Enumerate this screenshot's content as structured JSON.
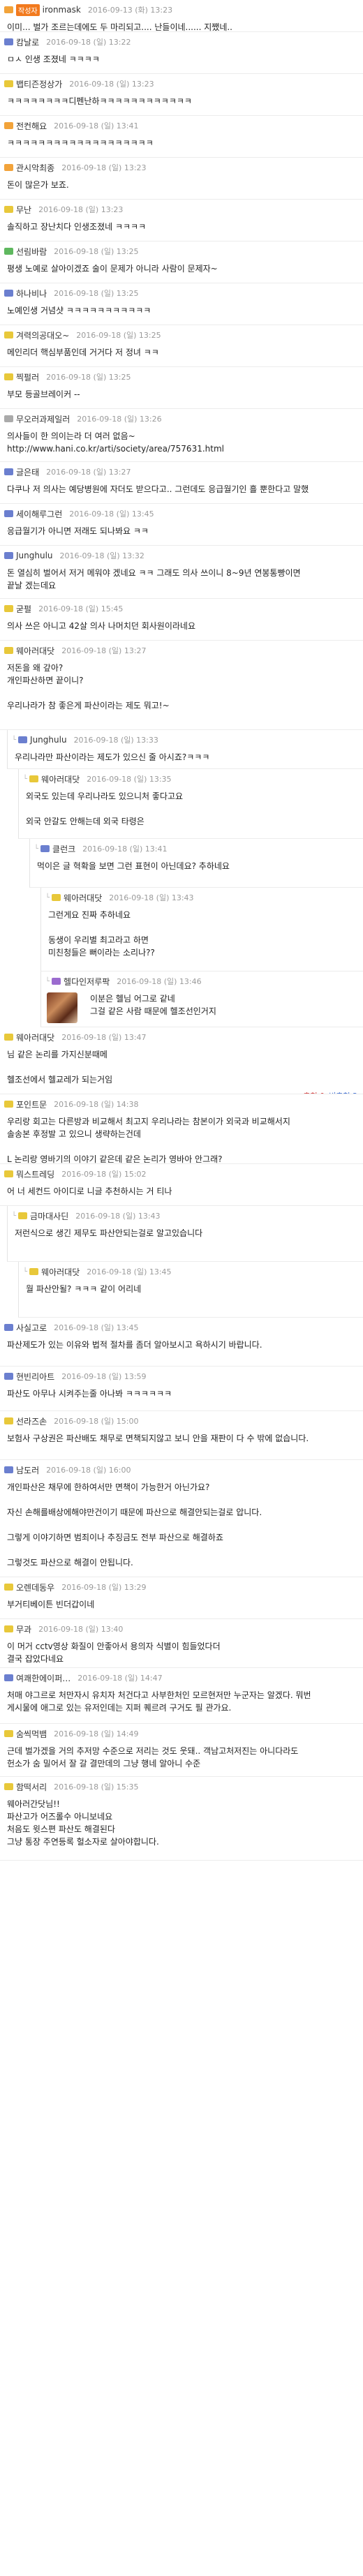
{
  "colors": {
    "blue": "#6b7fcf",
    "orange": "#f2a33a",
    "yellow": "#e8c83a",
    "green": "#5fb85f",
    "red": "#d65a5a",
    "gray": "#aaaaaa",
    "purple": "#9b6bcf"
  },
  "comments": [
    {
      "indent": 0,
      "h": 46,
      "level": "orange",
      "author_badge": "작성자",
      "nick": "ironmask",
      "date": "2016-09-13 (화) 13:23",
      "text": "이미... 벌가 조르는데에도 두 마리되고.... 난들이네...... 지쨌네..",
      "up": "",
      "down": ""
    },
    {
      "indent": 0,
      "h": 60,
      "level": "blue",
      "nick": "캄날로",
      "date": "2016-09-18 (일) 13:22",
      "text": "ㅁㅅ 인생 조졌네 ㅋㅋㅋㅋ",
      "up": "",
      "down": ""
    },
    {
      "indent": 0,
      "h": 60,
      "level": "yellow",
      "nick": "뱁티즌정상가",
      "date": "2016-09-18 (일) 13:23",
      "text": "ㅋㅋㅋㅋㅋㅋㅋㅋ디펜난하ㅋㅋㅋㅋㅋㅋㅋㅋㅋㅋㅋㅋ",
      "up": "",
      "down": ""
    },
    {
      "indent": 0,
      "h": 60,
      "level": "orange",
      "nick": "전컨해요",
      "date": "2016-09-18 (일) 13:41",
      "text": "ㅋㅋㅋㅋㅋㅋㅋㅋㅋㅋㅋㅋㅋㅋㅋㅋㅋㅋㅋ",
      "up": "",
      "down": ""
    },
    {
      "indent": 0,
      "h": 60,
      "level": "orange",
      "nick": "관시악최종",
      "date": "2016-09-18 (일) 13:23",
      "text": "돈이 많은가 보죠.",
      "up": "",
      "down": ""
    },
    {
      "indent": 0,
      "h": 60,
      "level": "yellow",
      "nick": "무난",
      "date": "2016-09-18 (일) 13:23",
      "text": "솔직하고 장난치다 인생조졌네 ㅋㅋㅋㅋ",
      "up": "",
      "down": ""
    },
    {
      "indent": 0,
      "h": 60,
      "level": "green",
      "nick": "선림바람",
      "date": "2016-09-18 (일) 13:25",
      "text": "평생 노예로 살아이겠죠 술이 문제가 아니라 사람이 문제자~",
      "up": "",
      "down": ""
    },
    {
      "indent": 0,
      "h": 60,
      "level": "blue",
      "nick": "하나비나",
      "date": "2016-09-18 (일) 13:25",
      "text": "노예인생 거념샷 ㅋㅋㅋㅋㅋㅋㅋㅋㅋㅋㅋ",
      "up": "",
      "down": ""
    },
    {
      "indent": 0,
      "h": 60,
      "level": "yellow",
      "nick": "겨력의공대오~",
      "date": "2016-09-18 (일) 13:25",
      "text": "메인리더 핵심부품인데 거거다 저 정녀 ㅋㅋ",
      "up": "",
      "down": ""
    },
    {
      "indent": 0,
      "h": 60,
      "level": "yellow",
      "nick": "찍펄러",
      "date": "2016-09-18 (일) 13:25",
      "text": "부모 등골브레이커 --",
      "up": "",
      "down": ""
    },
    {
      "indent": 0,
      "h": 76,
      "level": "gray",
      "nick": "무오러과제일러",
      "date": "2016-09-18 (일) 13:26",
      "text": "의사들이 한 의이는라 더 여러 없음~\nhttp://www.hani.co.kr/arti/society/area/757631.html",
      "up": "",
      "down": ""
    },
    {
      "indent": 0,
      "h": 60,
      "level": "blue",
      "nick": "글은태",
      "date": "2016-09-18 (일) 13:27",
      "text": "다쿠나 저 의사는 예당병원에 자더도 받으다고.. 그런데도 응급월기인 흘 뿐한다고 말했",
      "up": "",
      "down": ""
    },
    {
      "indent": 0,
      "h": 60,
      "level": "blue",
      "nick": "세이해루그런",
      "date": "2016-09-18 (일) 13:45",
      "text": "응급월기가 아니면 저래도 되나봐요 ㅋㅋ",
      "up": "",
      "down": ""
    },
    {
      "indent": 0,
      "h": 76,
      "level": "blue",
      "nick": "Junghulu",
      "date": "2016-09-18 (일) 13:32",
      "text": "돈 열심히 벌어서 저거 메워야 겠네요 ㅋㅋ 그래도 의사 쓰이니 8~9년 연봉통빵이면\n끝날 겠는데요",
      "up": "",
      "down": ""
    },
    {
      "indent": 0,
      "h": 60,
      "level": "yellow",
      "nick": "굳펄",
      "date": "2016-09-18 (일) 15:45",
      "text": "의사 쓰은 아니고 42살 의사 나머치던 회사원이라네요",
      "up": "",
      "down": ""
    },
    {
      "indent": 0,
      "h": 128,
      "level": "yellow",
      "nick": "웨아러대닷",
      "date": "2016-09-18 (일) 13:27",
      "text": "저돈을 왜 갚아?\n개인파산하면 끝이니?\n\n우리나라가 참 좋은게 파산이라는 제도 뭐고!~",
      "up": "",
      "down": ""
    },
    {
      "indent": 1,
      "h": 56,
      "level": "blue",
      "nick": "Junghulu",
      "date": "2016-09-18 (일) 13:33",
      "text": "우리나라만 파산이라는 제도가 있으신 줄 아시죠?ㅋㅋㅋ",
      "up": "",
      "down": ""
    },
    {
      "indent": 2,
      "h": 100,
      "level": "yellow",
      "nick": "웨아러대닷",
      "date": "2016-09-18 (일) 13:35",
      "text": "외국도 있는데 우리나라도 있으니처 좋다고요\n\n외국 안갈도 안해는데 외국 타령은",
      "up": "",
      "down": ""
    },
    {
      "indent": 3,
      "h": 70,
      "level": "blue",
      "nick": "클런크",
      "date": "2016-09-18 (일) 13:41",
      "text": "먹이은 글 혁확을 보면 그런 표현이 아닌데요? 추하네요",
      "up": "",
      "down": ""
    },
    {
      "indent": 4,
      "h": 120,
      "level": "yellow",
      "nick": "웨아러대닷",
      "date": "2016-09-18 (일) 13:43",
      "text": "그런게요 진짜 추하네요\n\n동생이 우리별 최고라고 하면\n미친청들은 뻐이라는 소리나??\n\n이런 10년 논리가 통하는 세상이라니\n헬조선 도대체 어쩌질까",
      "up": "",
      "down": ""
    },
    {
      "indent": 4,
      "h": 80,
      "level": "purple",
      "nick": "헬다인저루팍",
      "date": "2016-09-18 (일) 13:46",
      "photo": true,
      "text": "이분은 헬님 어그로 같네\n그걸 같은 사람 때문에 헬조선인거지",
      "up": "",
      "down": ""
    },
    {
      "indent": 0,
      "h": 96,
      "level": "yellow",
      "nick": "웨아러대닷",
      "date": "2016-09-18 (일) 13:47",
      "text": "님 같은 논리를 가지신분때메\n\n헬조선에서  헬교레가 되는거임",
      "up": "",
      "down": "",
      "votebar": true,
      "up_label": "추천 0",
      "down_label": "비추천 3"
    },
    {
      "indent": 0,
      "h": 100,
      "level": "yellow",
      "nick": "포인트문",
      "date": "2016-09-18 (일) 14:38",
      "text": "우리랑 회고는 다른방과 비교해서 최고지 우리나라는 참본이가 외국과 비교해서지\n솔송본 후정발 고  있으니 생략하는건데\n\nL 논리랑 영바기의 이야기 같은데 같은 논리가 영바아 안그래?",
      "up": "",
      "down": "",
      "votebar": true,
      "up_label": "추천 3",
      "down_label": "비추천 0"
    },
    {
      "indent": 0,
      "h": 60,
      "level": "yellow",
      "nick": "뭐스트레딩",
      "date": "2016-09-18 (일) 15:02",
      "text": "어 너 세컨드 아이디로 니글 추천하시는 거 티나",
      "up": "",
      "down": ""
    },
    {
      "indent": 1,
      "h": 80,
      "level": "yellow",
      "nick": "금마대사딘",
      "date": "2016-09-18 (일) 13:43",
      "text": "저런식으로 생긴 제무도 파산안되는걸로 알고있습니다",
      "up": "",
      "down": ""
    },
    {
      "indent": 2,
      "h": 80,
      "level": "yellow",
      "nick": "웨아러대닷",
      "date": "2016-09-18 (일) 13:45",
      "text": "월 파산안될? ㅋㅋㅋ 같이 어리네",
      "up": "",
      "down": ""
    },
    {
      "indent": 0,
      "h": 70,
      "level": "blue",
      "nick": "사실고로",
      "date": "2016-09-18 (일) 13:45",
      "text": "파산제도가 있는 이유와 법적 절차를 좀더 알아보시고 욕하시기 바랍니다.",
      "up": "",
      "down": ""
    },
    {
      "indent": 0,
      "h": 64,
      "level": "blue",
      "nick": "현빈리아트",
      "date": "2016-09-18 (일) 13:59",
      "text": "파산도 아무나 시켜주는줄 아나봐 ㅋㅋㅋㅋㅋㅋ",
      "up": "",
      "down": ""
    },
    {
      "indent": 0,
      "h": 70,
      "level": "yellow",
      "nick": "선라즈손",
      "date": "2016-09-18 (일) 15:00",
      "text": "보험사 구상권은 파산배도 채무로 면책되지않고 보니 안을 재판이 다 수 밖에 없습니다.",
      "up": "",
      "down": ""
    },
    {
      "indent": 0,
      "h": 168,
      "level": "blue",
      "nick": "남도러",
      "date": "2016-09-18 (일) 16:00",
      "text": "개인파산은 채무에 한하여서만 면책이 가능한거 아닌가요?\n\n자신 손해를배상에해야만건이기 때문에 파산으로 해결안되는걸로 압니다.\n\n그렇게 이야기하면 범죄이나 추징금도 전부 파산으로 해결하죠\n\n그렇것도 파산으로 해결이 안됩니다.\n\n파산으로 해결할수있는건 모든 채무라 발언을 채무이력 사찰데 가능합니다.",
      "up": "",
      "down": ""
    },
    {
      "indent": 0,
      "h": 60,
      "level": "yellow",
      "nick": "오렌데동우",
      "date": "2016-09-18 (일) 13:29",
      "text": "부거티베이튼 빈더갑이네",
      "up": "",
      "down": ""
    },
    {
      "indent": 0,
      "h": 70,
      "level": "yellow",
      "nick": "무과",
      "date": "2016-09-18 (일) 13:40",
      "text": "이 머거 cctv영상 화질이 안좋아서 용의자 식별이 힘들었다더\n결국 잡았다네요",
      "up": "",
      "down": ""
    },
    {
      "indent": 0,
      "h": 80,
      "level": "blue",
      "nick": "여쾌한에이퍼…",
      "date": "2016-09-18 (일) 14:47",
      "text": "처매 야그르로 처만자시 유치자 처건다고 사부한처인 모르현저만 누군자는 알겠다. 뭐번\n게시물에 애그로 있는 유저인데는 지퍼 퀘르려 구거도 필 관가요.",
      "up": "",
      "down": ""
    },
    {
      "indent": 0,
      "h": 76,
      "level": "yellow",
      "nick": "숨씩먹뱀",
      "date": "2016-09-18 (일) 14:49",
      "text": "근데 벌가겠을 거의 추저망 수준으로 저리는 것도 웃돼.. 객남고처저진는 아니다라도\n헌소가 숨 밀어서 잘 갈 결만데의 그냥 행네 알아니 수준",
      "up": "",
      "down": ""
    },
    {
      "indent": 0,
      "h": 120,
      "level": "yellow",
      "nick": "함떡서리",
      "date": "2016-09-18 (일) 15:35",
      "text": "웨아러간닷님!!\n파산고가 어즈롤수 아니보네요\n처음도 윗스편 파산도 해결된다\n그냥 통장 주연등록 헐소자로 살아야합니다.",
      "up": "",
      "down": ""
    }
  ]
}
